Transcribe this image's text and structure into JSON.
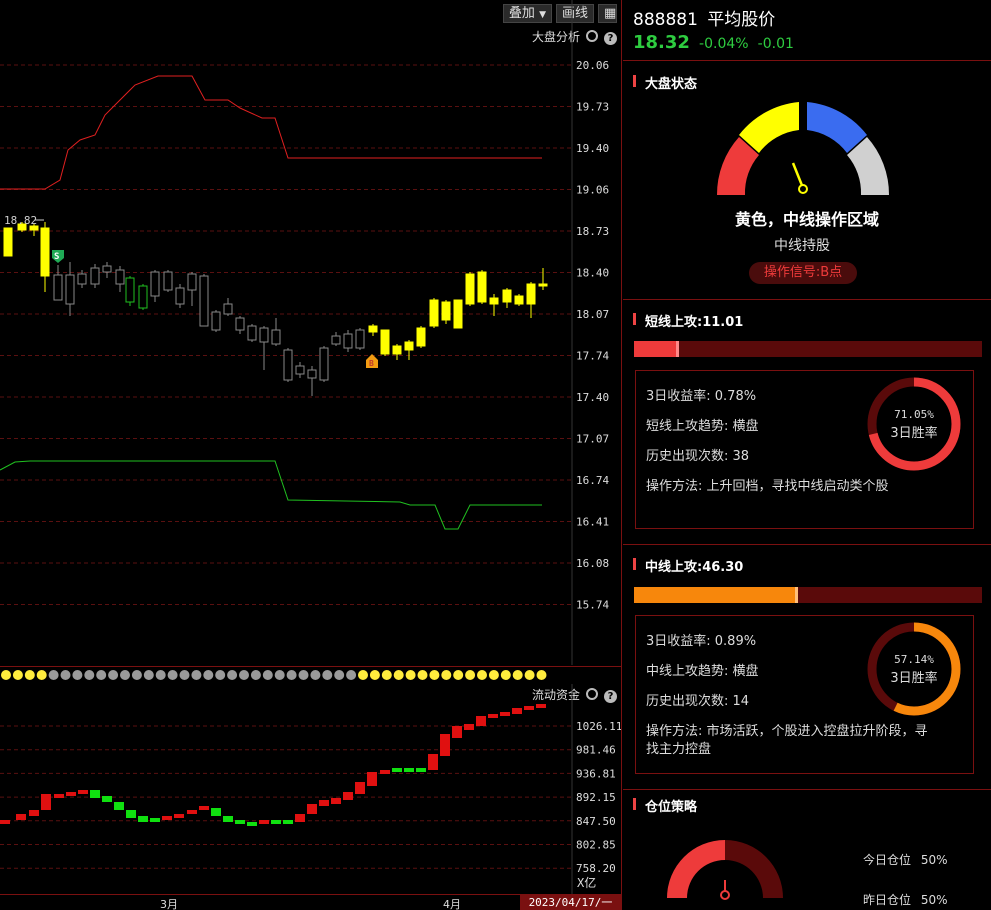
{
  "toolbar": {
    "overlay_label": "叠加",
    "draw_label": "画线"
  },
  "main_chart": {
    "title": "大盘分析",
    "price_labels": [
      "20.06",
      "19.73",
      "19.40",
      "19.06",
      "18.73",
      "18.40",
      "18.07",
      "17.74",
      "17.40",
      "17.07",
      "16.74",
      "16.41",
      "16.08",
      "15.74"
    ],
    "high_label": "18.82",
    "sell_marker": "S",
    "buy_marker": "B"
  },
  "flow_chart": {
    "title": "流动资金",
    "value_labels": [
      "1026.11",
      "981.46",
      "936.81",
      "892.15",
      "847.50",
      "802.85",
      "758.20"
    ],
    "unit": "X亿"
  },
  "time_axis": {
    "labels": [
      "3月",
      "4月"
    ],
    "current_date": "2023/04/17/一"
  },
  "stock": {
    "code": "888881",
    "name": "平均股价",
    "price": "18.32",
    "change_pct": "-0.04%",
    "change": "-0.01"
  },
  "market_status": {
    "header": "大盘状态",
    "zone_text": "黄色，中线操作区域",
    "advice": "中线持股",
    "signal": "操作信号:B点",
    "colors": {
      "red": "#ee3b3b",
      "yellow": "#ffff00",
      "blue": "#3a6cf0",
      "gray": "#d0d0d0"
    }
  },
  "short_attack": {
    "header": "短线上攻:11.01",
    "bar_fill": 0.13,
    "return_3d": "3日收益率: 0.78%",
    "trend": "短线上攻趋势: 横盘",
    "occurrences": "历史出现次数: 38",
    "method": "操作方法: 上升回档，寻找中线启动类个股",
    "win_rate": "71.05%",
    "win_label": "3日胜率"
  },
  "mid_attack": {
    "header": "中线上攻:46.30",
    "bar_fill": 0.47,
    "return_3d": "3日收益率: 0.89%",
    "trend": "中线上攻趋势: 横盘",
    "occurrences": "历史出现次数: 14",
    "method_line1": "操作方法: 市场活跃，个股进入控盘拉升阶段，寻",
    "method_line2": "找主力控盘",
    "win_rate": "57.14%",
    "win_label": "3日胜率"
  },
  "position": {
    "header": "仓位策略",
    "today_label": "今日仓位",
    "today_value": "50%",
    "yesterday_label": "昨日仓位",
    "yesterday_value": "50%"
  }
}
